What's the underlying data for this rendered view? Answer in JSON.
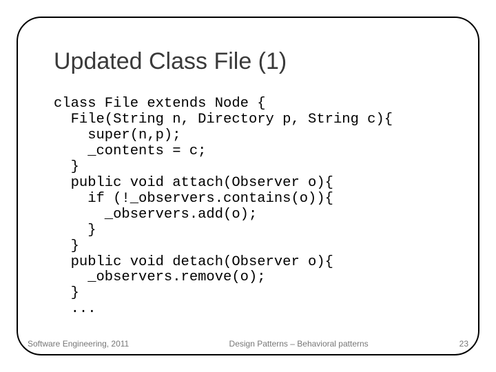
{
  "title": "Updated Class File (1)",
  "code": "class File extends Node {\n  File(String n, Directory p, String c){\n    super(n,p);\n    _contents = c;\n  }\n  public void attach(Observer o){\n    if (!_observers.contains(o)){\n      _observers.add(o);\n    }\n  }\n  public void detach(Observer o){\n    _observers.remove(o);\n  }\n  ...",
  "footer": {
    "left": "Software Engineering, 2011",
    "center": "Design Patterns – Behavioral patterns",
    "page": "23"
  }
}
